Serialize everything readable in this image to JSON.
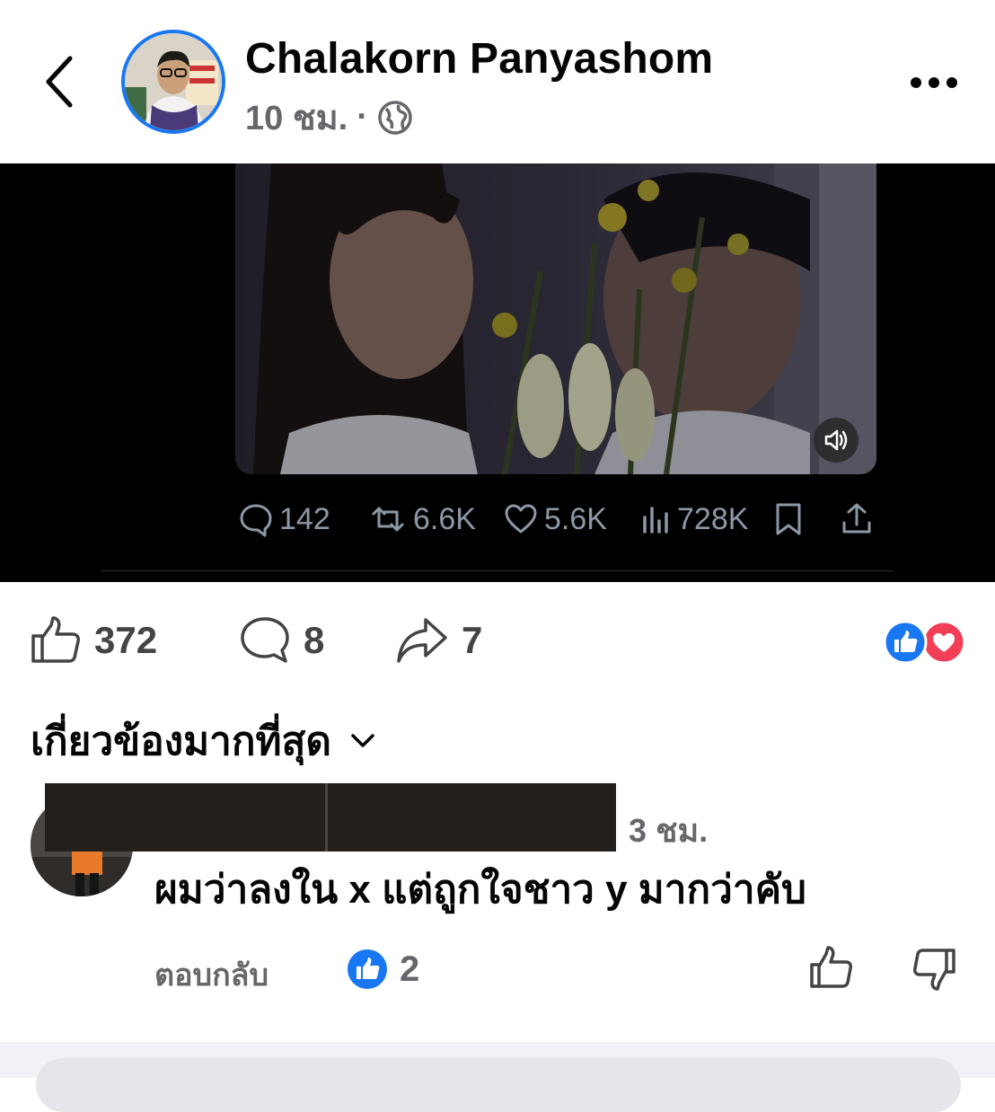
{
  "header": {
    "author": "Chalakorn Panyashom",
    "time": "10 ชม.",
    "separator": "·",
    "privacy_icon": "globe-icon",
    "more_icon": "more-horizontal-icon",
    "back_icon": "chevron-left-icon"
  },
  "embedded_post": {
    "speaker_icon": "volume-icon",
    "replies": "142",
    "reposts": "6.6K",
    "likes": "5.6K",
    "views": "728K",
    "bookmark_icon": "bookmark-icon",
    "share_icon": "share-up-icon"
  },
  "reactions_bar": {
    "likes": "372",
    "comments": "8",
    "shares": "7",
    "reaction_icons": [
      "like-reaction-icon",
      "love-reaction-icon"
    ]
  },
  "sort": {
    "label": "เกี่ยวข้องมากที่สุด",
    "icon": "chevron-down-icon"
  },
  "comment": {
    "time": "3 ชม.",
    "text": "ผมว่าลงใน x แต่ถูกใจชาว y มากว่าคับ",
    "reply_label": "ตอบกลับ",
    "like_count": "2"
  },
  "colors": {
    "facebook_blue": "#1877f2",
    "love_red": "#f33e58",
    "secondary_text": "#65676b",
    "x_gray": "#8b98a5"
  }
}
